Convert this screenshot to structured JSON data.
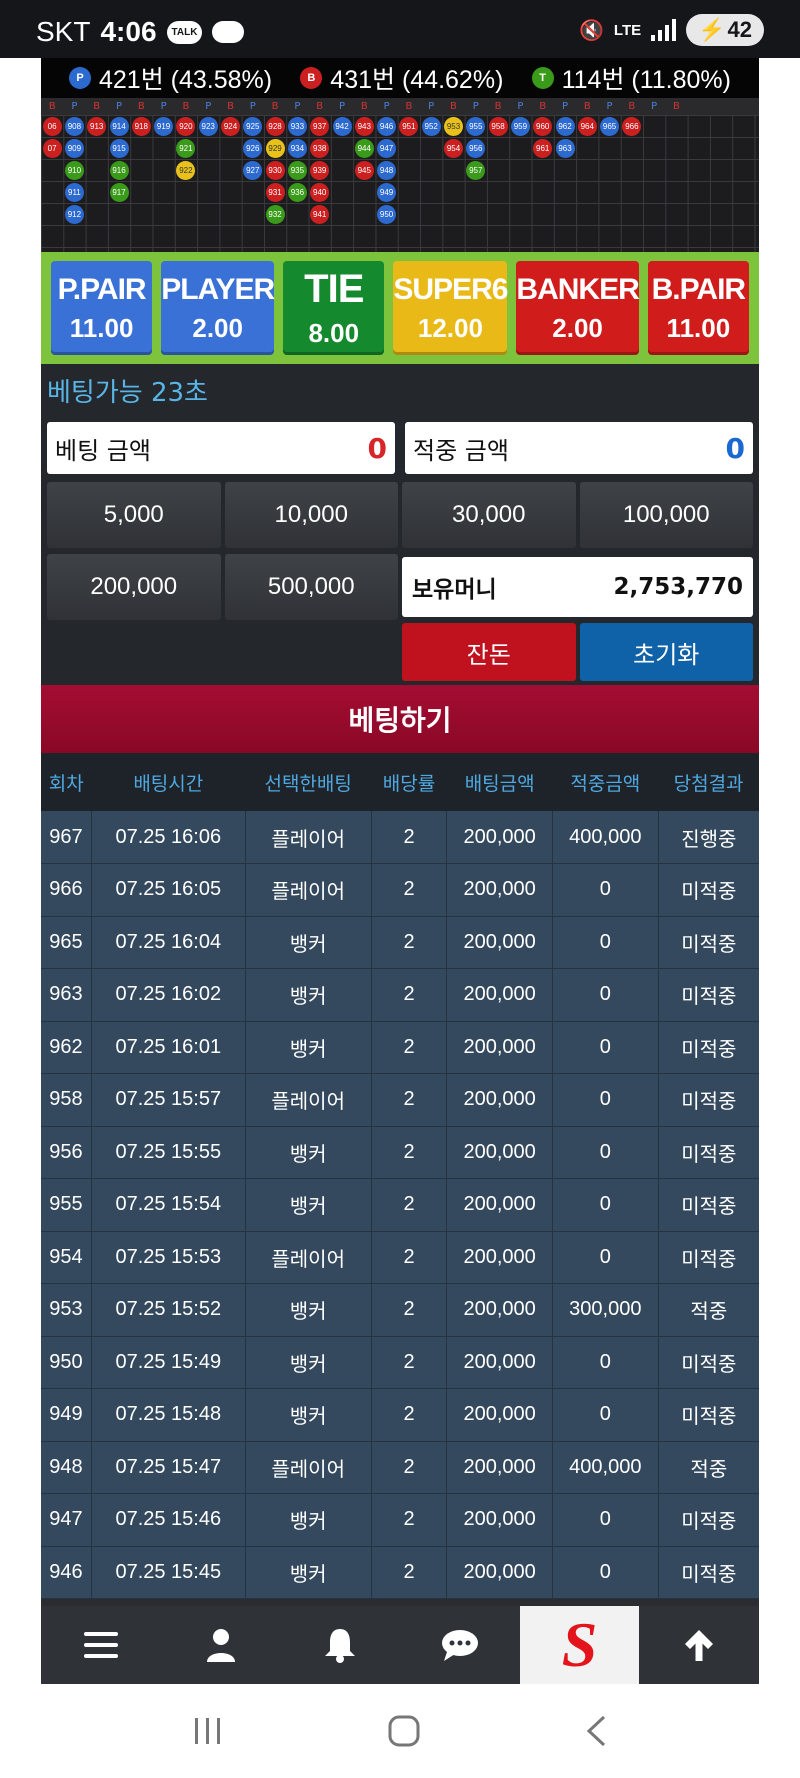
{
  "status_bar": {
    "carrier": "SKT",
    "time": "4:06",
    "talk": "TALK",
    "network": "LTE",
    "battery": "42"
  },
  "stats": {
    "player": {
      "badge": "P",
      "text": "421번 (43.58%)",
      "color": "#2c6ad0"
    },
    "banker": {
      "badge": "B",
      "text": "431번 (44.62%)",
      "color": "#cc2020"
    },
    "tie": {
      "badge": "T",
      "text": "114번 (11.80%)",
      "color": "#3a9a1a"
    }
  },
  "road_header": [
    "B",
    "P",
    "B",
    "P",
    "B",
    "P",
    "B",
    "P",
    "B",
    "P",
    "B",
    "P",
    "B",
    "P",
    "B",
    "P",
    "B",
    "P",
    "B",
    "P",
    "B",
    "P",
    "B",
    "P",
    "B",
    "P",
    "B",
    "P",
    "B"
  ],
  "beads": [
    {
      "c": 0,
      "r": 0,
      "t": "B",
      "n": "06"
    },
    {
      "c": 1,
      "r": 0,
      "t": "P",
      "n": "908"
    },
    {
      "c": 2,
      "r": 0,
      "t": "B",
      "n": "913"
    },
    {
      "c": 3,
      "r": 0,
      "t": "P",
      "n": "914"
    },
    {
      "c": 4,
      "r": 0,
      "t": "B",
      "n": "918"
    },
    {
      "c": 5,
      "r": 0,
      "t": "P",
      "n": "919"
    },
    {
      "c": 6,
      "r": 0,
      "t": "B",
      "n": "920"
    },
    {
      "c": 7,
      "r": 0,
      "t": "P",
      "n": "923"
    },
    {
      "c": 8,
      "r": 0,
      "t": "B",
      "n": "924"
    },
    {
      "c": 9,
      "r": 0,
      "t": "P",
      "n": "925"
    },
    {
      "c": 10,
      "r": 0,
      "t": "B",
      "n": "928"
    },
    {
      "c": 11,
      "r": 0,
      "t": "P",
      "n": "933"
    },
    {
      "c": 12,
      "r": 0,
      "t": "B",
      "n": "937"
    },
    {
      "c": 13,
      "r": 0,
      "t": "P",
      "n": "942"
    },
    {
      "c": 14,
      "r": 0,
      "t": "B",
      "n": "943"
    },
    {
      "c": 15,
      "r": 0,
      "t": "P",
      "n": "946"
    },
    {
      "c": 16,
      "r": 0,
      "t": "B",
      "n": "951"
    },
    {
      "c": 17,
      "r": 0,
      "t": "P",
      "n": "952"
    },
    {
      "c": 18,
      "r": 0,
      "t": "S",
      "n": "953"
    },
    {
      "c": 19,
      "r": 0,
      "t": "P",
      "n": "955"
    },
    {
      "c": 20,
      "r": 0,
      "t": "B",
      "n": "958"
    },
    {
      "c": 21,
      "r": 0,
      "t": "P",
      "n": "959"
    },
    {
      "c": 22,
      "r": 0,
      "t": "B",
      "n": "960"
    },
    {
      "c": 23,
      "r": 0,
      "t": "P",
      "n": "962"
    },
    {
      "c": 24,
      "r": 0,
      "t": "B",
      "n": "964"
    },
    {
      "c": 25,
      "r": 0,
      "t": "P",
      "n": "965"
    },
    {
      "c": 26,
      "r": 0,
      "t": "B",
      "n": "966"
    },
    {
      "c": 0,
      "r": 1,
      "t": "B",
      "n": "07"
    },
    {
      "c": 1,
      "r": 1,
      "t": "P",
      "n": "909"
    },
    {
      "c": 3,
      "r": 1,
      "t": "P",
      "n": "915"
    },
    {
      "c": 6,
      "r": 1,
      "t": "T",
      "n": "921"
    },
    {
      "c": 9,
      "r": 1,
      "t": "P",
      "n": "926"
    },
    {
      "c": 10,
      "r": 1,
      "t": "S",
      "n": "929"
    },
    {
      "c": 11,
      "r": 1,
      "t": "P",
      "n": "934"
    },
    {
      "c": 12,
      "r": 1,
      "t": "B",
      "n": "938"
    },
    {
      "c": 14,
      "r": 1,
      "t": "T",
      "n": "944"
    },
    {
      "c": 15,
      "r": 1,
      "t": "P",
      "n": "947"
    },
    {
      "c": 18,
      "r": 1,
      "t": "B",
      "n": "954"
    },
    {
      "c": 19,
      "r": 1,
      "t": "P",
      "n": "956"
    },
    {
      "c": 22,
      "r": 1,
      "t": "B",
      "n": "961"
    },
    {
      "c": 23,
      "r": 1,
      "t": "P",
      "n": "963"
    },
    {
      "c": 1,
      "r": 2,
      "t": "T",
      "n": "910"
    },
    {
      "c": 3,
      "r": 2,
      "t": "T",
      "n": "916"
    },
    {
      "c": 6,
      "r": 2,
      "t": "S",
      "n": "922"
    },
    {
      "c": 9,
      "r": 2,
      "t": "P",
      "n": "927"
    },
    {
      "c": 10,
      "r": 2,
      "t": "B",
      "n": "930"
    },
    {
      "c": 11,
      "r": 2,
      "t": "T",
      "n": "935"
    },
    {
      "c": 12,
      "r": 2,
      "t": "B",
      "n": "939"
    },
    {
      "c": 14,
      "r": 2,
      "t": "B",
      "n": "945"
    },
    {
      "c": 15,
      "r": 2,
      "t": "P",
      "n": "948"
    },
    {
      "c": 19,
      "r": 2,
      "t": "T",
      "n": "957"
    },
    {
      "c": 1,
      "r": 3,
      "t": "P",
      "n": "911"
    },
    {
      "c": 3,
      "r": 3,
      "t": "T",
      "n": "917"
    },
    {
      "c": 10,
      "r": 3,
      "t": "B",
      "n": "931"
    },
    {
      "c": 11,
      "r": 3,
      "t": "T",
      "n": "936"
    },
    {
      "c": 12,
      "r": 3,
      "t": "B",
      "n": "940"
    },
    {
      "c": 15,
      "r": 3,
      "t": "P",
      "n": "949"
    },
    {
      "c": 1,
      "r": 4,
      "t": "P",
      "n": "912"
    },
    {
      "c": 10,
      "r": 4,
      "t": "T",
      "n": "932"
    },
    {
      "c": 12,
      "r": 4,
      "t": "B",
      "n": "941"
    },
    {
      "c": 15,
      "r": 4,
      "t": "P",
      "n": "950"
    }
  ],
  "bet_options": [
    {
      "name": "P.PAIR",
      "odds": "11.00",
      "cls": "opt-ppair",
      "id": "bet-option-p-pair"
    },
    {
      "name": "PLAYER",
      "odds": "2.00",
      "cls": "opt-player",
      "id": "bet-option-player"
    },
    {
      "name": "TIE",
      "odds": "8.00",
      "cls": "opt-tie",
      "id": "bet-option-tie"
    },
    {
      "name": "SUPER6",
      "odds": "12.00",
      "cls": "opt-super6",
      "id": "bet-option-super6"
    },
    {
      "name": "BANKER",
      "odds": "2.00",
      "cls": "opt-banker",
      "id": "bet-option-banker"
    },
    {
      "name": "B.PAIR",
      "odds": "11.00",
      "cls": "opt-bpair",
      "id": "bet-option-b-pair"
    }
  ],
  "betting": {
    "timer_text": "베팅가능 23초",
    "bet_amount_label": "베팅 금액",
    "bet_amount_value": "0",
    "win_amount_label": "적중 금액",
    "win_amount_value": "0",
    "chips": [
      "5,000",
      "10,000",
      "30,000",
      "100,000",
      "200,000",
      "500,000"
    ],
    "balance_label": "보유머니",
    "balance_value": "2,753,770",
    "change_label": "잔돈",
    "reset_label": "초기화",
    "submit_label": "베팅하기"
  },
  "history": {
    "headers": [
      "회차",
      "배팅시간",
      "선택한배팅",
      "배당률",
      "배팅금액",
      "적중금액",
      "당첨결과"
    ],
    "rows": [
      [
        "967",
        "07.25 16:06",
        "플레이어",
        "2",
        "200,000",
        "400,000",
        "진행중",
        "prog"
      ],
      [
        "966",
        "07.25 16:05",
        "플레이어",
        "2",
        "200,000",
        "0",
        "미적중",
        "miss"
      ],
      [
        "965",
        "07.25 16:04",
        "뱅커",
        "2",
        "200,000",
        "0",
        "미적중",
        "miss"
      ],
      [
        "963",
        "07.25 16:02",
        "뱅커",
        "2",
        "200,000",
        "0",
        "미적중",
        "miss"
      ],
      [
        "962",
        "07.25 16:01",
        "뱅커",
        "2",
        "200,000",
        "0",
        "미적중",
        "miss"
      ],
      [
        "958",
        "07.25 15:57",
        "플레이어",
        "2",
        "200,000",
        "0",
        "미적중",
        "miss"
      ],
      [
        "956",
        "07.25 15:55",
        "뱅커",
        "2",
        "200,000",
        "0",
        "미적중",
        "miss"
      ],
      [
        "955",
        "07.25 15:54",
        "뱅커",
        "2",
        "200,000",
        "0",
        "미적중",
        "miss"
      ],
      [
        "954",
        "07.25 15:53",
        "플레이어",
        "2",
        "200,000",
        "0",
        "미적중",
        "miss"
      ],
      [
        "953",
        "07.25 15:52",
        "뱅커",
        "2",
        "200,000",
        "300,000",
        "적중",
        "hit"
      ],
      [
        "950",
        "07.25 15:49",
        "뱅커",
        "2",
        "200,000",
        "0",
        "미적중",
        "miss"
      ],
      [
        "949",
        "07.25 15:48",
        "뱅커",
        "2",
        "200,000",
        "0",
        "미적중",
        "miss"
      ],
      [
        "948",
        "07.25 15:47",
        "플레이어",
        "2",
        "200,000",
        "400,000",
        "적중",
        "hit"
      ],
      [
        "947",
        "07.25 15:46",
        "뱅커",
        "2",
        "200,000",
        "0",
        "미적중",
        "miss"
      ],
      [
        "946",
        "07.25 15:45",
        "뱅커",
        "2",
        "200,000",
        "0",
        "미적중",
        "miss"
      ]
    ]
  },
  "bottom_nav": [
    "menu-icon",
    "user-icon",
    "bell-icon",
    "chat-icon",
    "site-logo",
    "arrow-up-icon"
  ],
  "logo_letter": "S"
}
